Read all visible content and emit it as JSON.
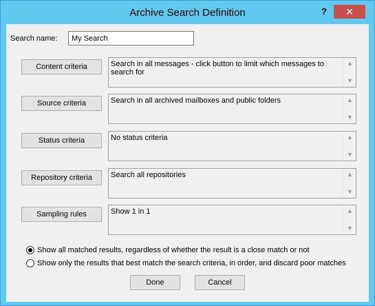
{
  "window": {
    "title": "Archive Search Definition",
    "help_glyph": "?",
    "close_glyph": "✕"
  },
  "search_name": {
    "label": "Search name:",
    "value": "My Search"
  },
  "criteria": [
    {
      "button": "Content criteria",
      "text": "Search in all messages - click button to limit which messages to search for"
    },
    {
      "button": "Source criteria",
      "text": "Search in all archived mailboxes and public folders"
    },
    {
      "button": "Status criteria",
      "text": "No status criteria"
    },
    {
      "button": "Repository criteria",
      "text": "Search all repositories"
    },
    {
      "button": "Sampling rules",
      "text": "Show 1 in 1"
    }
  ],
  "scroll_icons": {
    "up": "up-arrow-icon",
    "down": "down-arrow-icon"
  },
  "results_options": [
    {
      "label": "Show all matched results, regardless of whether the result is a close match or not",
      "selected": true
    },
    {
      "label": "Show only the results that best match the search criteria, in order, and discard poor matches",
      "selected": false
    }
  ],
  "footer": {
    "done_label": "Done",
    "cancel_label": "Cancel"
  },
  "colors": {
    "titlebar": "#5fc9f0",
    "close_button": "#c7504a",
    "client_bg": "#f0f0f0"
  }
}
